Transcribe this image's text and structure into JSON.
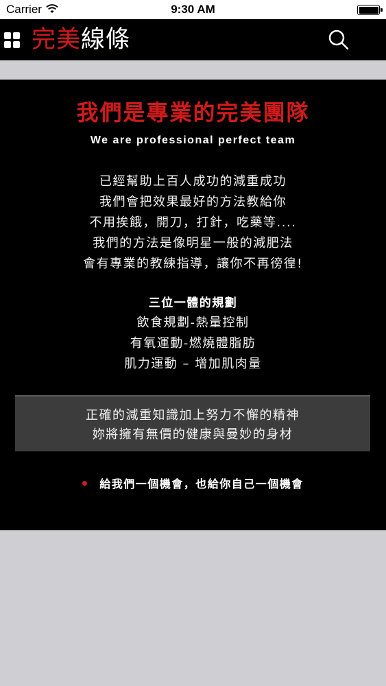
{
  "status_bar": {
    "carrier": "Carrier",
    "time": "9:30 AM",
    "wifi_icon": "wifi-icon",
    "battery_icon": "battery-icon"
  },
  "header": {
    "brand_part1": "完美",
    "brand_part2": "線條",
    "menu_icon": "grid-menu-icon",
    "search_icon": "search-icon",
    "brand_red": "#d11a1a"
  },
  "main": {
    "headline": "我們是專業的完美團隊",
    "subheadline": "We are professional perfect team",
    "intro_lines": [
      "已經幫助上百人成功的減重成功",
      "我們會把效果最好的方法教給你",
      "不用挨餓，開刀，打針，吃藥等....",
      "我們的方法是像明星一般的減肥法",
      "會有專業的教練指導，讓你不再徬徨!"
    ],
    "plan_title": "三位一體的規劃",
    "plan_items": [
      "飲食規劃-熱量控制",
      "有氧運動-燃燒體脂肪",
      "肌力運動 – 增加肌肉量"
    ],
    "quote_lines": [
      "正確的減重知識加上努力不懈的精神",
      "妳將擁有無價的健康與曼妙的身材"
    ],
    "footer_text": "給我們一個機會，也給你自己一個機會"
  },
  "colors": {
    "accent_red": "#d11a1a",
    "content_bg": "#000000",
    "page_bg": "#cfcfd3",
    "quote_bg": "#3c3c3c"
  }
}
